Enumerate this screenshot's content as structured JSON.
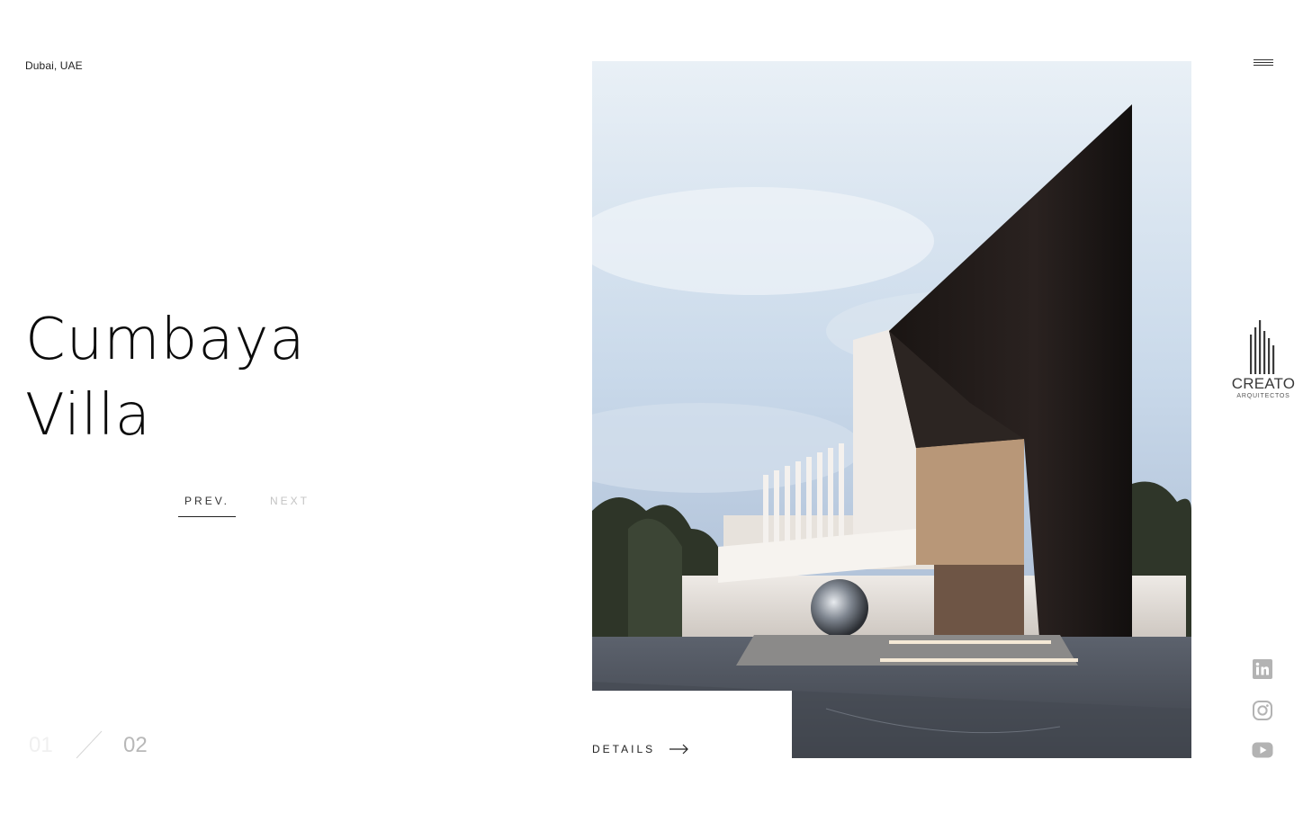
{
  "header": {
    "location": "Dubai, UAE"
  },
  "project": {
    "title_line1": "Cumbaya",
    "title_line2": "Villa"
  },
  "navigation": {
    "prev_label": "PREV.",
    "next_label": "NEXT"
  },
  "counter": {
    "current": "01",
    "total": "02"
  },
  "details": {
    "label": "DETAILS"
  },
  "brand": {
    "name": "CREATO",
    "tagline": "ARQUITECTOS"
  },
  "icons": {
    "menu": "hamburger-menu-icon",
    "details_arrow": "arrow-right-icon",
    "social": [
      "linkedin-icon",
      "instagram-icon",
      "youtube-icon"
    ]
  },
  "colors": {
    "text": "#111111",
    "muted": "#c4c4c4",
    "icon": "#b3b3b3",
    "background": "#ffffff"
  }
}
